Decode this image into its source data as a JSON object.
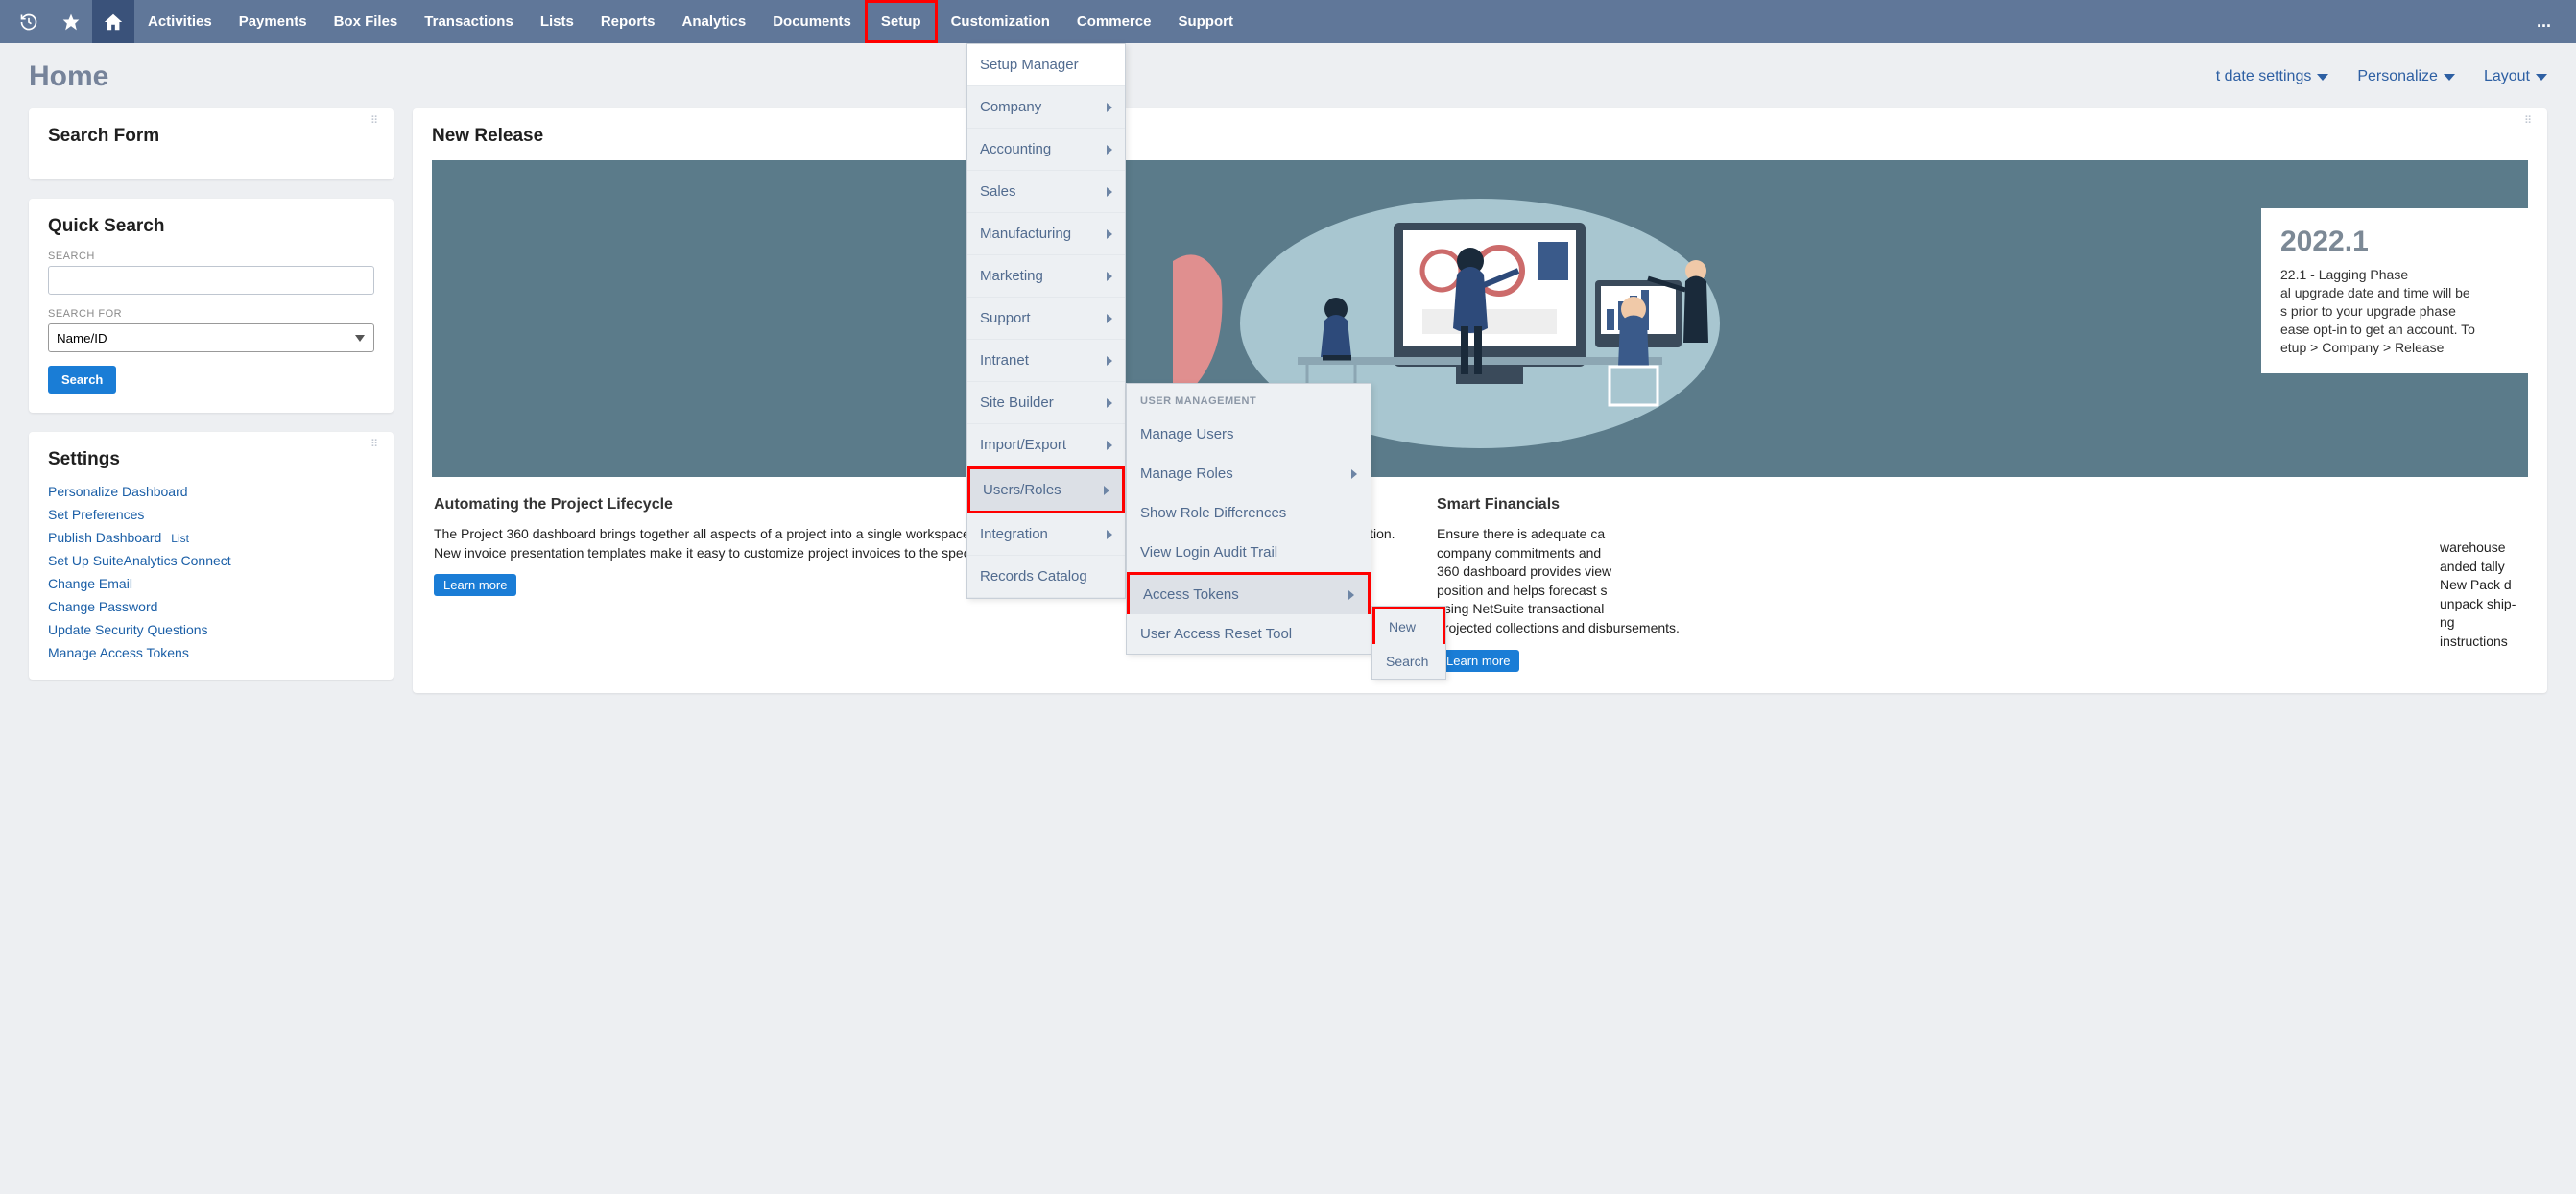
{
  "topnav": {
    "items": [
      "Activities",
      "Payments",
      "Box Files",
      "Transactions",
      "Lists",
      "Reports",
      "Analytics",
      "Documents",
      "Setup",
      "Customization",
      "Commerce",
      "Support"
    ],
    "more": "..."
  },
  "page_title": "Home",
  "subheader": {
    "date_settings": "t date settings",
    "personalize": "Personalize",
    "layout": "Layout"
  },
  "search_form": {
    "title": "Search Form"
  },
  "quick_search": {
    "title": "Quick Search",
    "search_label": "SEARCH",
    "search_for_label": "SEARCH FOR",
    "search_for_value": "Name/ID",
    "button": "Search"
  },
  "settings": {
    "title": "Settings",
    "links": [
      "Personalize Dashboard",
      "Set Preferences",
      "Publish Dashboard",
      "Set Up SuiteAnalytics Connect",
      "Change Email",
      "Change Password",
      "Update Security Questions",
      "Manage Access Tokens"
    ],
    "publish_sub": "List"
  },
  "new_release": {
    "title": "New Release",
    "card": {
      "heading": "2022.1",
      "body": "22.1 - Lagging Phase\nal upgrade date and time will be\ns prior to your upgrade phase\nease opt-in to get an account. To\netup > Company > Release"
    },
    "article1": {
      "heading": "Automating the Project Lifecycle",
      "body": "The Project 360 dashboard brings together all aspects of a project into a single workspace and gives project managers visibility into all project-related information. New invoice presentation templates make it easy to customize project invoices to the specific needs of each client.",
      "cta": "Learn more"
    },
    "article2": {
      "heading": "Smart Financials",
      "body": "Ensure there is adequate ca\ncompany commitments and \n360 dashboard provides view\nposition and helps forecast s\nusing NetSuite transactional\nprojected collections and disbursements.",
      "cta": "Learn more"
    }
  },
  "setup_menu": {
    "top": "Setup Manager",
    "items": [
      "Company",
      "Accounting",
      "Sales",
      "Manufacturing",
      "Marketing",
      "Support",
      "Intranet",
      "Site Builder",
      "Import/Export",
      "Users/Roles",
      "Integration",
      "Records Catalog"
    ]
  },
  "users_roles_menu": {
    "section": "USER MANAGEMENT",
    "items": [
      "Manage Users",
      "Manage Roles",
      "Show Role Differences",
      "View Login Audit Trail",
      "Access Tokens",
      "User Access Reset Tool"
    ]
  },
  "flyout": {
    "new": "New",
    "search": "Search"
  },
  "cut_column": {
    "text": "warehouse anded tally New Pack d unpack ship- ng instructions"
  }
}
